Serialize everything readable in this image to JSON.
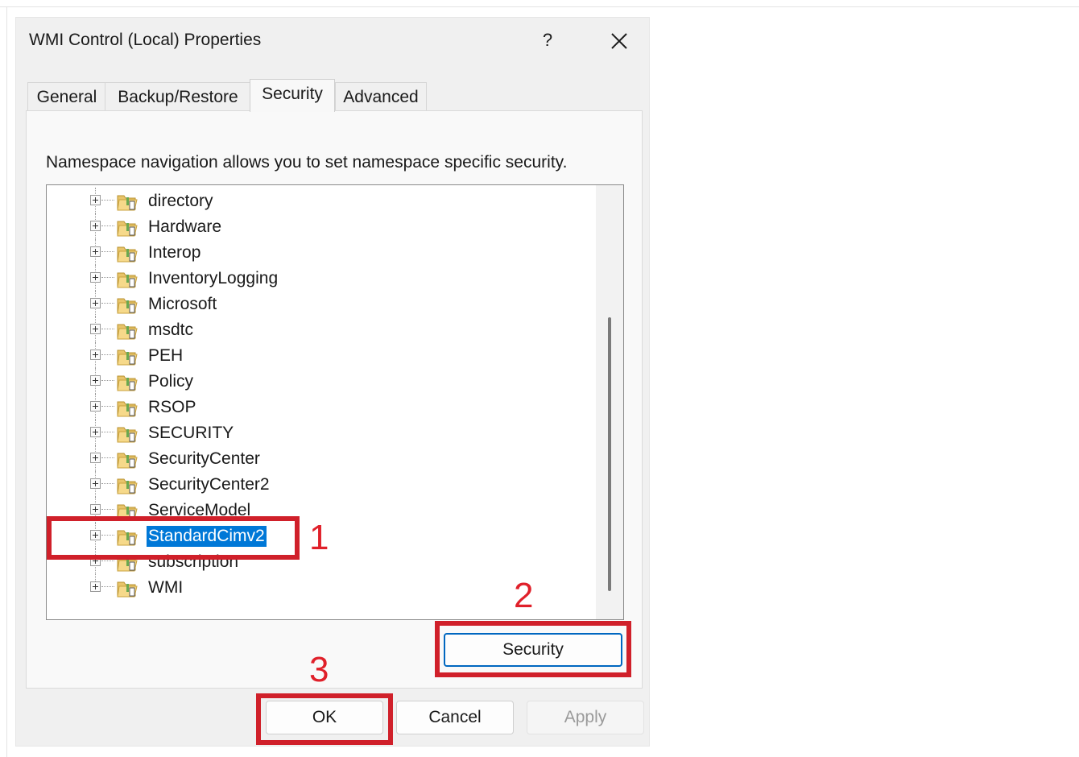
{
  "dialog": {
    "title": "WMI Control (Local) Properties",
    "help_label": "?",
    "tabs": [
      {
        "label": "General",
        "active": false
      },
      {
        "label": "Backup/Restore",
        "active": false
      },
      {
        "label": "Security",
        "active": true
      },
      {
        "label": "Advanced",
        "active": false
      }
    ],
    "instruction": "Namespace navigation allows you to set namespace specific security.",
    "tree": {
      "items": [
        {
          "label": "directory"
        },
        {
          "label": "Hardware"
        },
        {
          "label": "Interop"
        },
        {
          "label": "InventoryLogging"
        },
        {
          "label": "Microsoft"
        },
        {
          "label": "msdtc"
        },
        {
          "label": "PEH"
        },
        {
          "label": "Policy"
        },
        {
          "label": "RSOP"
        },
        {
          "label": "SECURITY"
        },
        {
          "label": "SecurityCenter"
        },
        {
          "label": "SecurityCenter2"
        },
        {
          "label": "ServiceModel"
        },
        {
          "label": "StandardCimv2"
        },
        {
          "label": "subscription"
        },
        {
          "label": "WMI"
        }
      ],
      "selected_item": "StandardCimv2"
    },
    "security_button": "Security",
    "footer": {
      "ok": "OK",
      "cancel": "Cancel",
      "apply": "Apply"
    }
  },
  "annotations": {
    "step1": "1",
    "step2": "2",
    "step3": "3",
    "color": "#d0202a"
  },
  "colors": {
    "selection": "#0078d7",
    "focus_border": "#0067c0",
    "dialog_bg": "#f0f0f0"
  }
}
